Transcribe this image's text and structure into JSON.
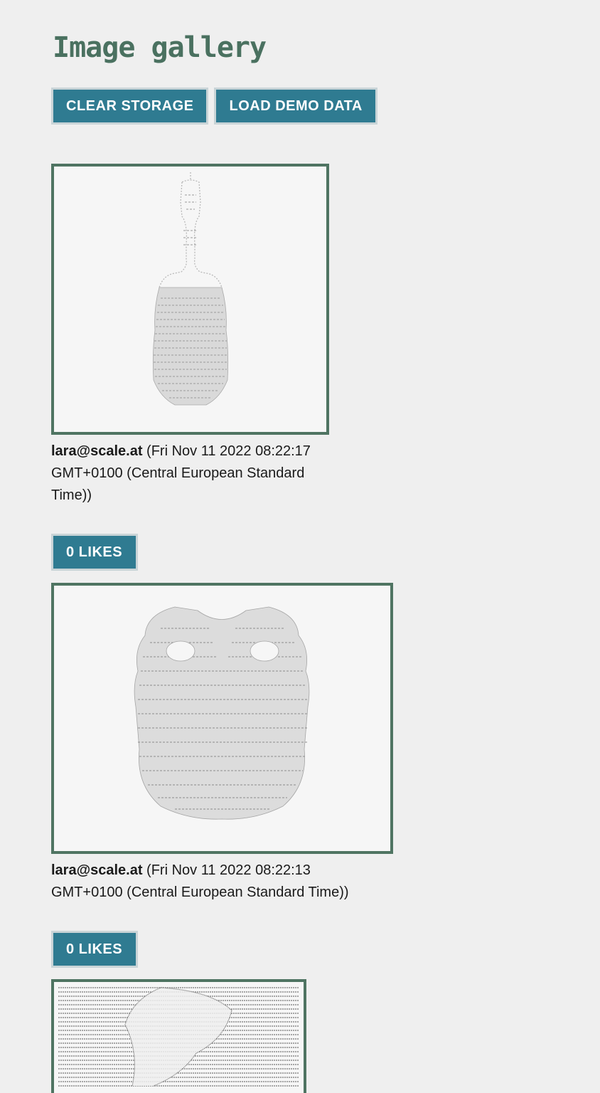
{
  "header": {
    "title": "Image gallery"
  },
  "toolbar": {
    "clear_label": "CLEAR STORAGE",
    "load_label": "LOAD DEMO DATA"
  },
  "posts": [
    {
      "author": "lara@scale.at",
      "date_line1": " (Fri Nov 11 2022 08:22:17",
      "date_line2": "GMT+0100 (Central European Standard",
      "date_line3": "Time))",
      "likes_label": "0 LIKES",
      "image_kind": "ascii-art-bottle"
    },
    {
      "author": "lara@scale.at",
      "date_line1": " (Fri Nov 11 2022 08:22:13",
      "date_line2": "GMT+0100 (Central European Standard Time))",
      "likes_label": "0 LIKES",
      "image_kind": "ascii-art-binoculars"
    },
    {
      "image_kind": "ascii-art-dense"
    }
  ],
  "colors": {
    "accent": "#2f7b91",
    "title": "#4a7160",
    "frame": "#4f7462",
    "background": "#efefef"
  }
}
